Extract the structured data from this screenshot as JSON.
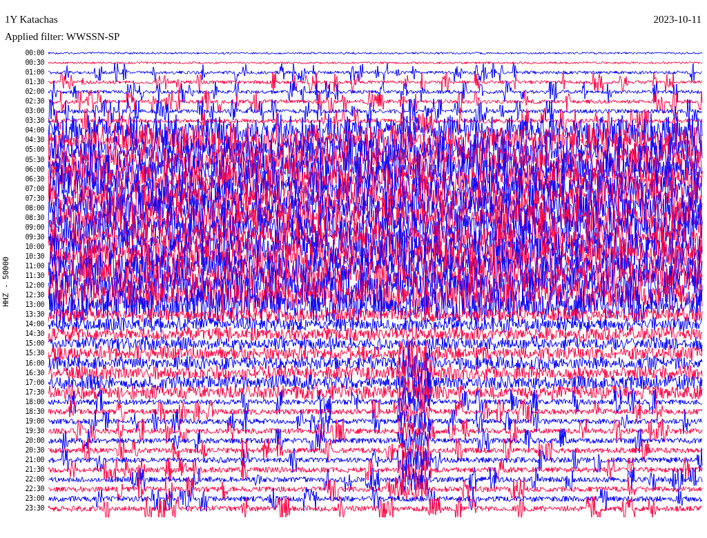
{
  "header": {
    "station": "1Y Katachas",
    "filter": "Applied filter: WWSSN-SP",
    "date": "2023-10-11"
  },
  "axis_label": "HHZ - 50000",
  "rows": [
    {
      "label": "00:00",
      "color": "#0000ff"
    },
    {
      "label": "00:30",
      "color": "#ff0040"
    },
    {
      "label": "01:00",
      "color": "#0000ff"
    },
    {
      "label": "01:30",
      "color": "#ff0040"
    },
    {
      "label": "02:00",
      "color": "#0000ff"
    },
    {
      "label": "02:30",
      "color": "#ff0040"
    },
    {
      "label": "03:00",
      "color": "#0000ff"
    },
    {
      "label": "03:30",
      "color": "#ff0040"
    },
    {
      "label": "04:00",
      "color": "#0000ff"
    },
    {
      "label": "04:30",
      "color": "#ff0040"
    },
    {
      "label": "05:00",
      "color": "#0000ff"
    },
    {
      "label": "05:30",
      "color": "#ff0040"
    },
    {
      "label": "06:00",
      "color": "#0000ff"
    },
    {
      "label": "06:30",
      "color": "#ff0040"
    },
    {
      "label": "07:00",
      "color": "#0000ff"
    },
    {
      "label": "07:30",
      "color": "#ff0040"
    },
    {
      "label": "08:00",
      "color": "#0000ff"
    },
    {
      "label": "08:30",
      "color": "#ff0040"
    },
    {
      "label": "09:00",
      "color": "#0000ff"
    },
    {
      "label": "09:30",
      "color": "#ff0040"
    },
    {
      "label": "10:00",
      "color": "#0000ff"
    },
    {
      "label": "10:30",
      "color": "#ff0040"
    },
    {
      "label": "11:00",
      "color": "#0000ff"
    },
    {
      "label": "11:30",
      "color": "#ff0040"
    },
    {
      "label": "12:00",
      "color": "#0000ff"
    },
    {
      "label": "12:30",
      "color": "#ff0040"
    },
    {
      "label": "13:00",
      "color": "#0000ff"
    },
    {
      "label": "13:30",
      "color": "#ff0040"
    },
    {
      "label": "14:00",
      "color": "#0000ff"
    },
    {
      "label": "14:30",
      "color": "#ff0040"
    },
    {
      "label": "15:00",
      "color": "#0000ff"
    },
    {
      "label": "15:30",
      "color": "#ff0040"
    },
    {
      "label": "16:00",
      "color": "#0000ff"
    },
    {
      "label": "16:30",
      "color": "#ff0040"
    },
    {
      "label": "17:00",
      "color": "#0000ff"
    },
    {
      "label": "17:30",
      "color": "#ff0040"
    },
    {
      "label": "18:00",
      "color": "#0000ff"
    },
    {
      "label": "18:30",
      "color": "#ff0040"
    },
    {
      "label": "19:00",
      "color": "#0000ff"
    },
    {
      "label": "19:30",
      "color": "#ff0040"
    },
    {
      "label": "20:00",
      "color": "#0000ff"
    },
    {
      "label": "20:30",
      "color": "#ff0040"
    },
    {
      "label": "21:00",
      "color": "#0000ff"
    },
    {
      "label": "21:30",
      "color": "#ff0040"
    },
    {
      "label": "22:00",
      "color": "#0000ff"
    },
    {
      "label": "22:30",
      "color": "#ff0040"
    },
    {
      "label": "23:00",
      "color": "#0000ff"
    },
    {
      "label": "23:30",
      "color": "#ff0040"
    }
  ]
}
